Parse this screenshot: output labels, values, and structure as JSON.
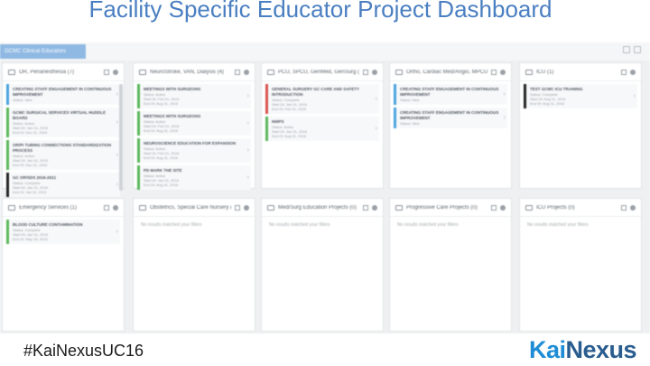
{
  "slide": {
    "title": "Facility Specific Educator Project Dashboard",
    "hashtag": "#KaiNexusUC16",
    "logo": {
      "part1": "Kai",
      "part2": "Nexus"
    }
  },
  "app": {
    "workspace_tab": "GCMC Clinical Educators",
    "empty_text": "No results matched your filters",
    "columns": [
      {
        "title": "OR, Perianesthesia (7)",
        "items": [
          {
            "title": "Creating staff engagement in continuous improvement",
            "meta": [
              "Status: New"
            ],
            "color": "blue"
          },
          {
            "title": "GCMC surgical services virtual huddle board",
            "meta": [
              "Status: Active",
              "Start Dt: Jan 01, 2016",
              "End Dt: Dec 31, 2016"
            ],
            "color": "green"
          },
          {
            "title": "OR/PI tubing connections standardization process",
            "meta": [
              "Status: Active",
              "Start Dt: Jan 01, 2016",
              "End Dt: Dec 31, 2016"
            ],
            "color": "green"
          },
          {
            "title": "GC OR/SDS 2016-2021",
            "meta": [
              "Status: Complete",
              "Start Dt: Jan 01, 2016",
              "End Dt: Jan 31, 2021"
            ],
            "color": "black"
          }
        ]
      },
      {
        "title": "NeuroStroke, VAN, Dialysis (4)",
        "items": [
          {
            "title": "Meetings with surgeons",
            "meta": [
              "Status: Active",
              "Start Dt: Feb 01, 2016",
              "End Dt: Aug 31, 2016"
            ],
            "color": "green"
          },
          {
            "title": "Meetings with surgeons",
            "meta": [
              "Status: Active",
              "Start Dt: Feb 01, 2016",
              "End Dt: Aug 31, 2016"
            ],
            "color": "green"
          },
          {
            "title": "Neuroscience education for expansion",
            "meta": [
              "Status: Active",
              "Start Dt: Feb 01, 2016",
              "End Dt: Aug 31, 2016"
            ],
            "color": "green"
          },
          {
            "title": "PD mark the site",
            "meta": [
              "Status: Active",
              "Start Dt: Jan 01, 2016",
              "End Dt: Aug 31, 2016"
            ],
            "color": "green"
          }
        ]
      },
      {
        "title": "PCU, SPCU, GenMed, GenSurg (2)",
        "items": [
          {
            "title": "General surgery GC care and safety introduction",
            "meta": [
              "Status: Complete",
              "Start Dt: Jan 01, 2016",
              "End Dt: Feb 01, 2016"
            ],
            "color": "red"
          },
          {
            "title": "NWPS",
            "meta": [
              "Status: Active",
              "Start Dt: Jan 01, 2016",
              "End Dt: Aug 31, 2016"
            ],
            "color": "green"
          }
        ]
      },
      {
        "title": "Ortho, Cardiac Med/Angio, MPCU, C...",
        "items": [
          {
            "title": "Creating staff engagement in continuous improvement",
            "meta": [
              "Status: New"
            ],
            "color": "blue"
          },
          {
            "title": "Creating staff engagement in continuous improvement",
            "meta": [
              "Status: New"
            ],
            "color": "blue"
          }
        ]
      },
      {
        "title": "ICU (1)",
        "items": [
          {
            "title": "Test GCMC ICU training",
            "meta": [
              "Status: Complete",
              "Start Dt: Aug 01, 2016",
              "End Dt: Aug 31, 2016"
            ],
            "color": "black"
          }
        ]
      },
      {
        "title": "Emergency Services (1)",
        "items": [
          {
            "title": "Blood culture contamination",
            "meta": [
              "Status: Complete",
              "Start Dt: Jan 01, 2016",
              "End Dt: May 26, 2016"
            ],
            "color": "green"
          }
        ]
      },
      {
        "title": "Obstetrics, Special Care Nursery (0)",
        "items": []
      },
      {
        "title": "Med/Surg Education Projects (0)",
        "items": []
      },
      {
        "title": "Progressive Care Projects (0)",
        "items": []
      },
      {
        "title": "ICU Projects (0)",
        "items": []
      }
    ]
  }
}
